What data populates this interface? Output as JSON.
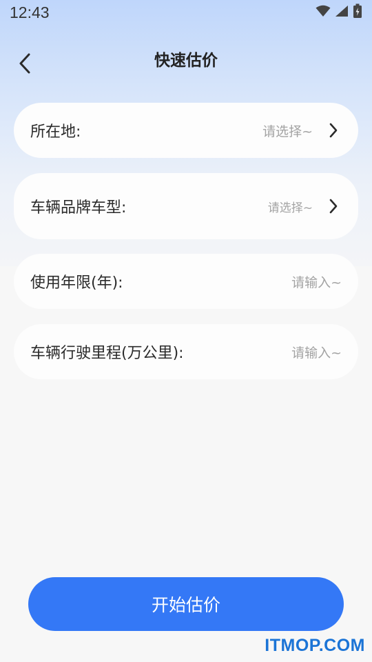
{
  "status_bar": {
    "time": "12:43",
    "icons": [
      "wifi-icon",
      "signal-icon",
      "battery-icon"
    ]
  },
  "header": {
    "title": "快速估价",
    "back_icon": "chevron-left-icon"
  },
  "form": {
    "fields": [
      {
        "label": "所在地:",
        "value": "请选择~",
        "type": "select"
      },
      {
        "label": "车辆品牌车型:",
        "value": "请选择~",
        "type": "select"
      },
      {
        "label": "使用年限(年):",
        "value": "请输入~",
        "type": "input"
      },
      {
        "label": "车辆行驶里程(万公里):",
        "value": "请输入~",
        "type": "input"
      }
    ]
  },
  "actions": {
    "submit_label": "开始估价"
  },
  "watermark": "ITMOP.COM",
  "colors": {
    "accent": "#3478f6",
    "gradient_top": "#bfd6fb",
    "background": "#f7f7f7",
    "card": "#fdfdfd",
    "placeholder": "#a3a3a3",
    "watermark": "#1b74d6"
  }
}
